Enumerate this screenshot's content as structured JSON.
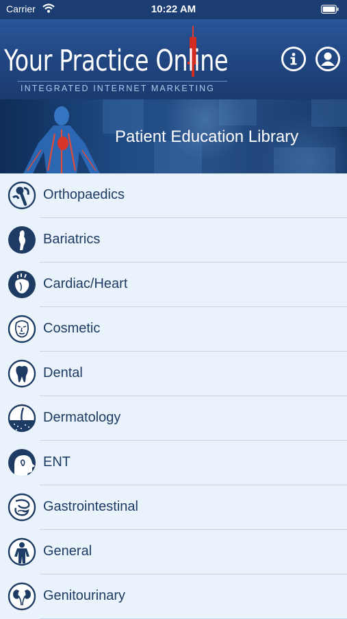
{
  "status_bar": {
    "carrier": "Carrier",
    "time": "10:22 AM"
  },
  "header": {
    "logo_title": "Your Practice Online",
    "logo_subtitle": "INTEGRATED INTERNET MARKETING"
  },
  "banner": {
    "title": "Patient Education Library"
  },
  "categories": [
    {
      "label": "Orthopaedics",
      "icon": "joint-icon"
    },
    {
      "label": "Bariatrics",
      "icon": "body-silhouette-icon"
    },
    {
      "label": "Cardiac/Heart",
      "icon": "heart-icon"
    },
    {
      "label": "Cosmetic",
      "icon": "face-icon"
    },
    {
      "label": "Dental",
      "icon": "tooth-icon"
    },
    {
      "label": "Dermatology",
      "icon": "skin-hair-icon"
    },
    {
      "label": "ENT",
      "icon": "head-profile-icon"
    },
    {
      "label": "Gastrointestinal",
      "icon": "stomach-icon"
    },
    {
      "label": "General",
      "icon": "human-figure-icon"
    },
    {
      "label": "Genitourinary",
      "icon": "kidney-icon"
    }
  ],
  "colors": {
    "header_bg": "#20457f",
    "list_bg": "#eaf3fb",
    "label": "#1d3b63",
    "icon": "#1d3b63"
  }
}
